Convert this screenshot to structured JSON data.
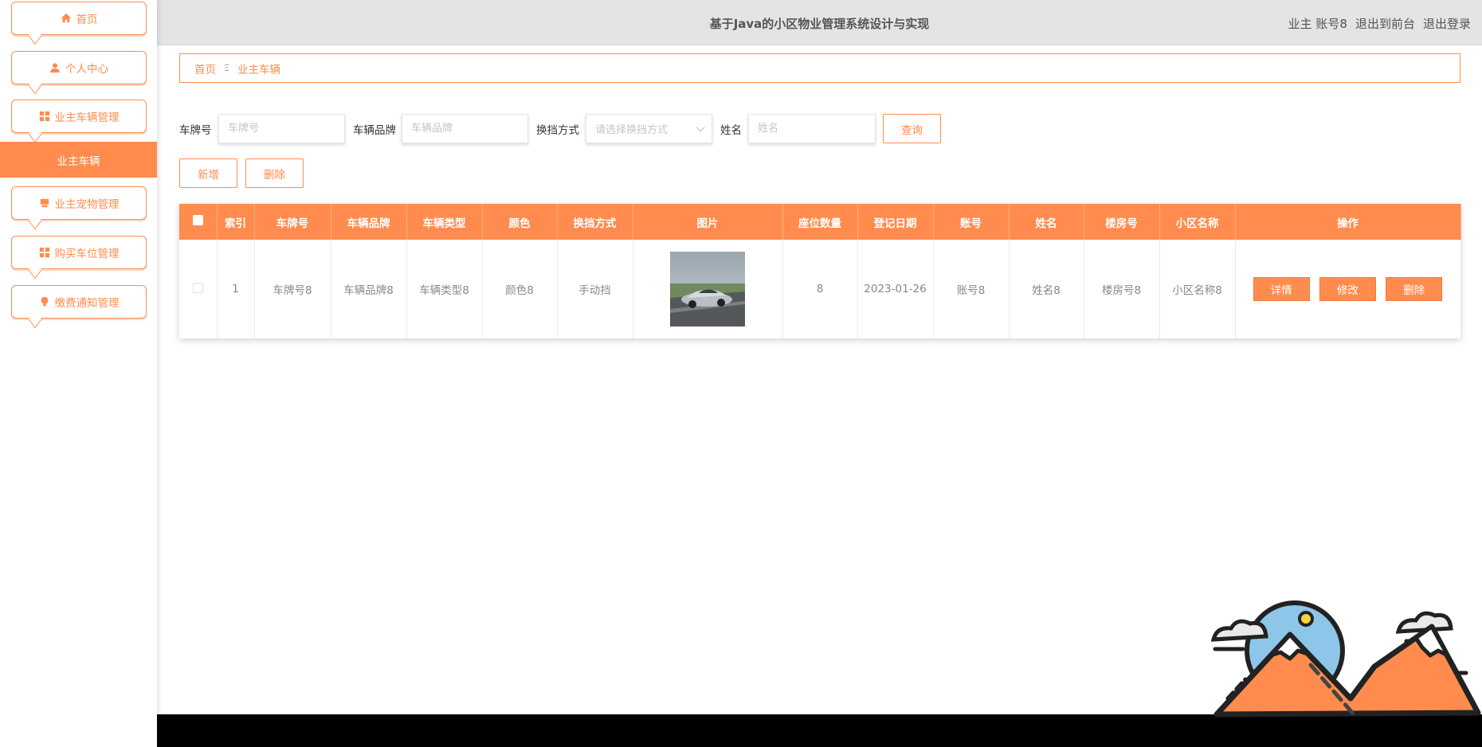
{
  "colors": {
    "accent": "#FF8C4E",
    "header_bg": "#e4e4e4",
    "footer_bg": "#000000"
  },
  "sidebar": {
    "items": [
      {
        "label": "首页",
        "icon": "home-icon"
      },
      {
        "label": "个人中心",
        "icon": "user-icon"
      },
      {
        "label": "业主车辆管理",
        "icon": "grid-icon"
      },
      {
        "label": "业主宠物管理",
        "icon": "pet-icon"
      },
      {
        "label": "购买车位管理",
        "icon": "grid-icon"
      },
      {
        "label": "缴费通知管理",
        "icon": "bulb-icon"
      }
    ],
    "active_sub": "业主车辆"
  },
  "header": {
    "title": "基于Java的小区物业管理系统设计与实现",
    "role": "业主",
    "username": "账号8",
    "back_front": "退出到前台",
    "logout": "退出登录"
  },
  "breadcrumb": {
    "home": "首页",
    "separator": "Ξ",
    "current": "业主车辆"
  },
  "search": {
    "plate_label": "车牌号",
    "plate_placeholder": "车牌号",
    "brand_label": "车辆品牌",
    "brand_placeholder": "车辆品牌",
    "gear_label": "换挡方式",
    "gear_placeholder": "请选择换挡方式",
    "name_label": "姓名",
    "name_placeholder": "姓名",
    "query_button": "查询"
  },
  "actions": {
    "add": "新增",
    "delete": "删除"
  },
  "table": {
    "columns": [
      "索引",
      "车牌号",
      "车辆品牌",
      "车辆类型",
      "颜色",
      "换挡方式",
      "图片",
      "座位数量",
      "登记日期",
      "账号",
      "姓名",
      "楼房号",
      "小区名称",
      "操作"
    ],
    "rows": [
      {
        "index": "1",
        "plate": "车牌号8",
        "brand": "车辆品牌8",
        "type": "车辆类型8",
        "color": "颜色8",
        "gear": "手动挡",
        "seats": "8",
        "date": "2023-01-26",
        "account": "账号8",
        "name": "姓名8",
        "building": "楼房号8",
        "community": "小区名称8",
        "ops": {
          "detail": "详情",
          "edit": "修改",
          "delete": "删除"
        }
      }
    ]
  }
}
